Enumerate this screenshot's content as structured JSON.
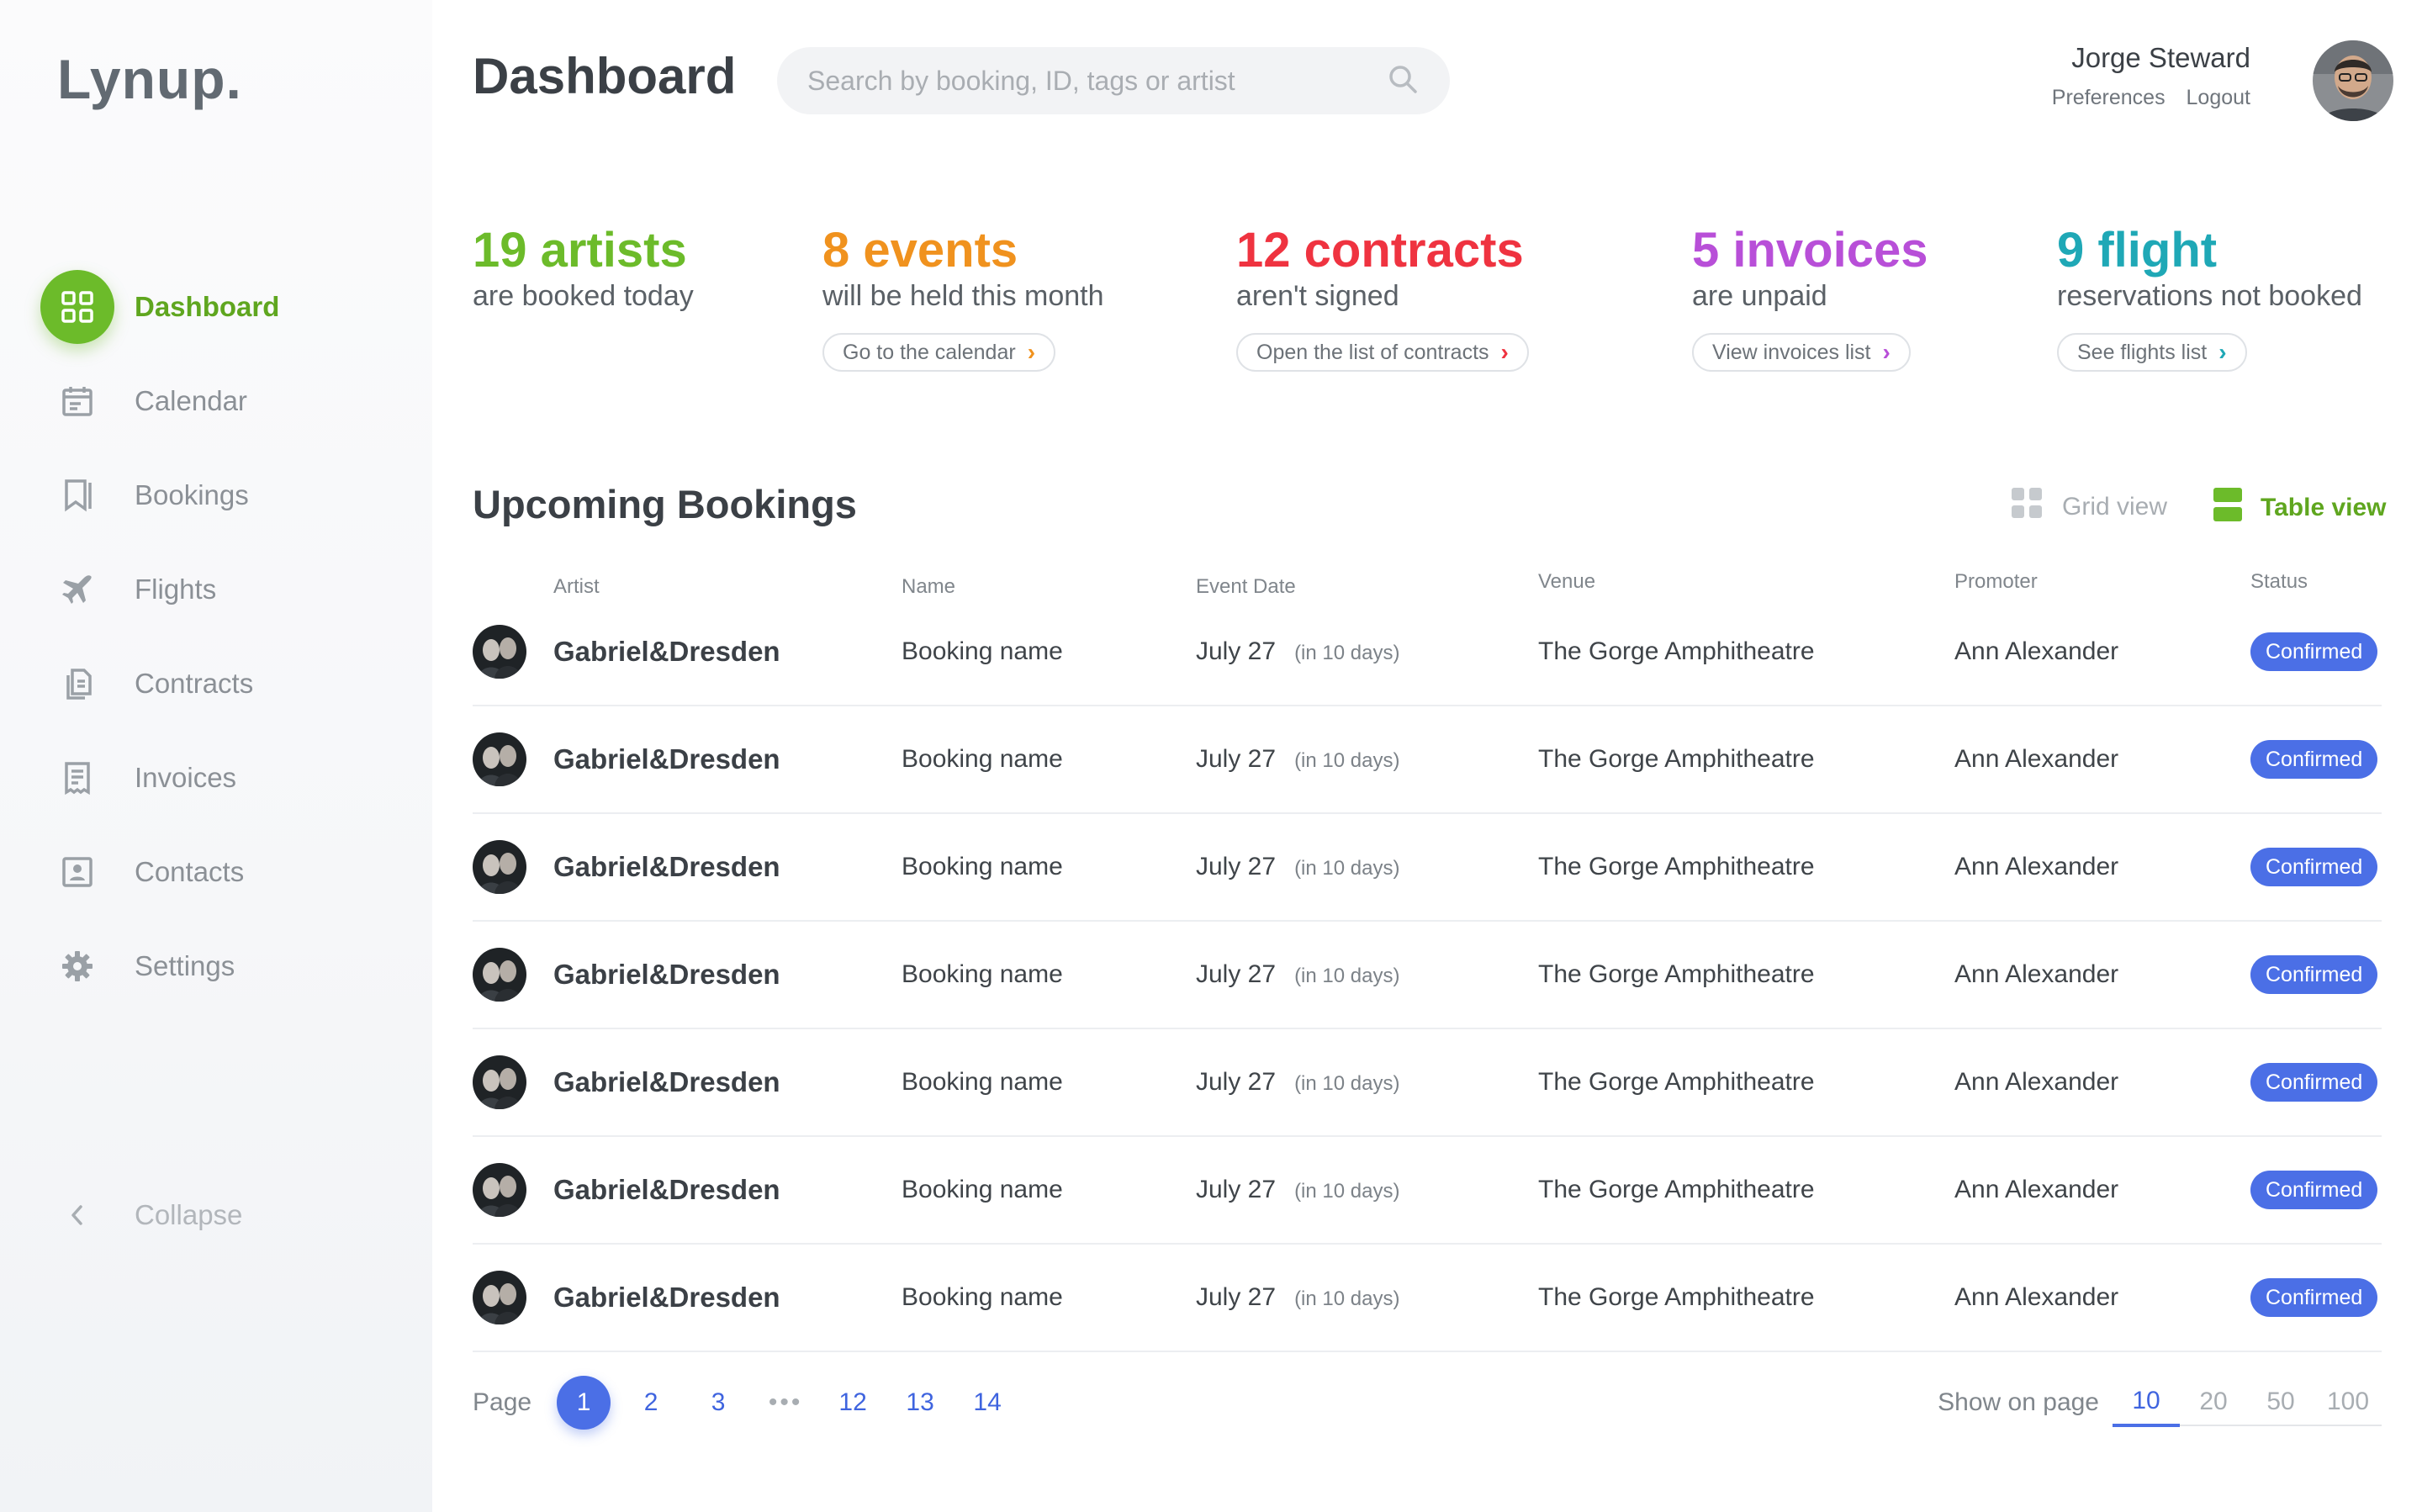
{
  "app": {
    "logo": "Lynup."
  },
  "sidebar": {
    "items": [
      {
        "label": "Dashboard",
        "icon": "dashboard-icon",
        "active": true
      },
      {
        "label": "Calendar",
        "icon": "calendar-icon"
      },
      {
        "label": "Bookings",
        "icon": "bookmark-icon"
      },
      {
        "label": "Flights",
        "icon": "airplane-icon"
      },
      {
        "label": "Contracts",
        "icon": "documents-icon"
      },
      {
        "label": "Invoices",
        "icon": "receipt-icon"
      },
      {
        "label": "Contacts",
        "icon": "contact-card-icon"
      },
      {
        "label": "Settings",
        "icon": "gear-icon"
      }
    ],
    "collapse_label": "Collapse"
  },
  "header": {
    "title": "Dashboard",
    "search_placeholder": "Search by booking, ID, tags or artist",
    "user_name": "Jorge Steward",
    "preferences": "Preferences",
    "logout": "Logout"
  },
  "stats": [
    {
      "big": "19 artists",
      "sub": "are booked today",
      "link": null,
      "color": "#6cbb2a"
    },
    {
      "big": "8 events",
      "sub": "will be held this month",
      "link": "Go to the calendar",
      "color": "#f0921e"
    },
    {
      "big": "12 contracts",
      "sub": "aren't signed",
      "link": "Open the list of contracts",
      "color": "#ef3340"
    },
    {
      "big": "5 invoices",
      "sub": "are unpaid",
      "link": "View invoices list",
      "color": "#b84fd8"
    },
    {
      "big": "9 flight",
      "sub": "reservations not booked",
      "link": "See flights list",
      "color": "#1fa8b6"
    }
  ],
  "bookings": {
    "title": "Upcoming Bookings",
    "grid_view": "Grid view",
    "table_view": "Table view",
    "columns": {
      "artist": "Artist",
      "name": "Name",
      "event_date": "Event Date",
      "venue": "Venue",
      "promoter": "Promoter",
      "status": "Status"
    },
    "rows": [
      {
        "artist": "Gabriel&Dresden",
        "name": "Booking name",
        "date": "July 27",
        "relative": "(in 10 days)",
        "venue": "The Gorge Amphitheatre",
        "promoter": "Ann Alexander",
        "status": "Confirmed"
      },
      {
        "artist": "Gabriel&Dresden",
        "name": "Booking name",
        "date": "July 27",
        "relative": "(in 10 days)",
        "venue": "The Gorge Amphitheatre",
        "promoter": "Ann Alexander",
        "status": "Confirmed"
      },
      {
        "artist": "Gabriel&Dresden",
        "name": "Booking name",
        "date": "July 27",
        "relative": "(in 10 days)",
        "venue": "The Gorge Amphitheatre",
        "promoter": "Ann Alexander",
        "status": "Confirmed"
      },
      {
        "artist": "Gabriel&Dresden",
        "name": "Booking name",
        "date": "July 27",
        "relative": "(in 10 days)",
        "venue": "The Gorge Amphitheatre",
        "promoter": "Ann Alexander",
        "status": "Confirmed"
      },
      {
        "artist": "Gabriel&Dresden",
        "name": "Booking name",
        "date": "July 27",
        "relative": "(in 10 days)",
        "venue": "The Gorge Amphitheatre",
        "promoter": "Ann Alexander",
        "status": "Confirmed"
      },
      {
        "artist": "Gabriel&Dresden",
        "name": "Booking name",
        "date": "July 27",
        "relative": "(in 10 days)",
        "venue": "The Gorge Amphitheatre",
        "promoter": "Ann Alexander",
        "status": "Confirmed"
      },
      {
        "artist": "Gabriel&Dresden",
        "name": "Booking name",
        "date": "July 27",
        "relative": "(in 10 days)",
        "venue": "The Gorge Amphitheatre",
        "promoter": "Ann Alexander",
        "status": "Confirmed"
      }
    ]
  },
  "pagination": {
    "label": "Page",
    "pages": [
      "1",
      "2",
      "3",
      "•••",
      "12",
      "13",
      "14"
    ],
    "current": "1",
    "show_label": "Show on page",
    "sizes": [
      "10",
      "20",
      "50",
      "100"
    ],
    "current_size": "10"
  },
  "colors": {
    "accent_green": "#6cbb2a",
    "accent_blue": "#4b6fe6"
  }
}
